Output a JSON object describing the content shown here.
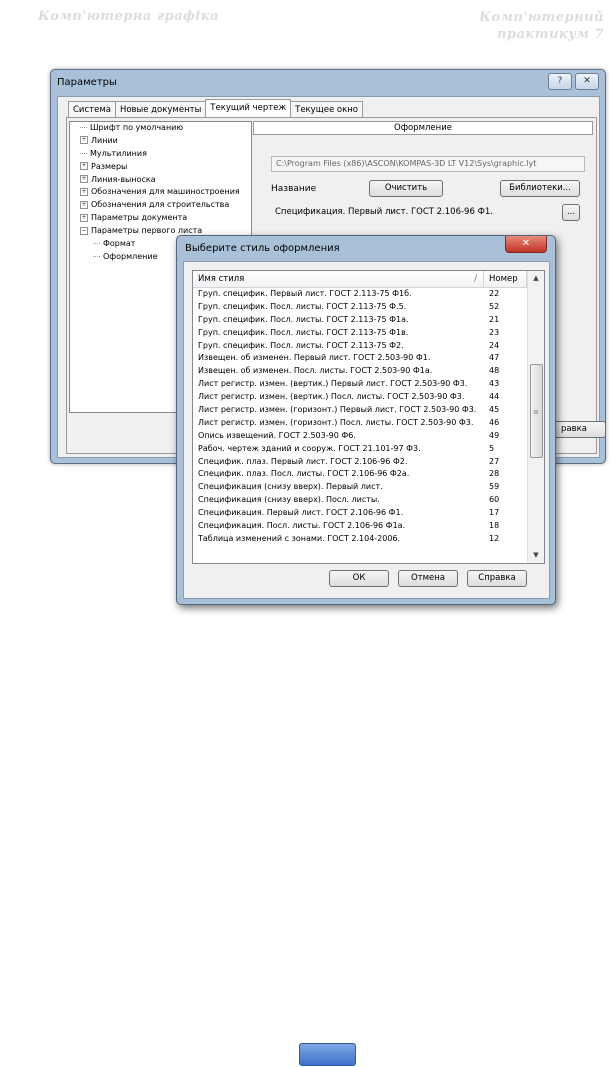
{
  "page_header": {
    "left": "Комп'ютерна графіка",
    "right_line1": "Комп'ютерний",
    "right_line2": "практикум 7"
  },
  "params_window": {
    "title": "Параметры",
    "help_icon": "?",
    "close_icon": "✕",
    "tabs": [
      "Система",
      "Новые документы",
      "Текущий чертеж",
      "Текущее окно"
    ],
    "active_tab": "Текущий чертеж",
    "tree": [
      {
        "label": "Шрифт по умолчанию",
        "expandable": false
      },
      {
        "label": "Линии",
        "expandable": true
      },
      {
        "label": "Мультилиния",
        "expandable": false
      },
      {
        "label": "Размеры",
        "expandable": true
      },
      {
        "label": "Линия-выноска",
        "expandable": true
      },
      {
        "label": "Обозначения для машиностроения",
        "expandable": true
      },
      {
        "label": "Обозначения для строительства",
        "expandable": true
      },
      {
        "label": "Параметры документа",
        "expandable": true
      },
      {
        "label": "Параметры первого листа",
        "expandable": true,
        "expanded": true
      },
      {
        "label": "Формат",
        "expandable": false,
        "child": true
      },
      {
        "label": "Оформление",
        "expandable": false,
        "child": true
      }
    ],
    "panel_title": "Оформление",
    "file_path": "C:\\Program Files (x86)\\ASCON\\KOMPAS-3D LT V12\\Sys\\graphic.lyt",
    "name_label": "Название",
    "clear_button": "Очистить",
    "libraries_button": "Библиотеки...",
    "style_value": "Спецификация. Первый лист. ГОСТ 2.106-96 Ф1.",
    "dots_button": "...",
    "bottom_button_partial": "равка"
  },
  "style_dialog": {
    "title": "Выберите стиль оформления",
    "close_icon": "✕",
    "col_name": "Имя стиля",
    "sort_indicator": "/",
    "col_number": "Номер",
    "rows": [
      {
        "name": "Груп. специфик. Первый лист. ГОСТ 2.113-75 Ф1б.",
        "num": "22"
      },
      {
        "name": "Груп. специфик. Посл. листы. ГОСТ 2.113-75 Ф.5.",
        "num": "52"
      },
      {
        "name": "Груп. специфик. Посл. листы. ГОСТ 2.113-75 Ф1а.",
        "num": "21"
      },
      {
        "name": "Груп. специфик. Посл. листы. ГОСТ 2.113-75 Ф1в.",
        "num": "23"
      },
      {
        "name": "Груп. специфик. Посл. листы. ГОСТ 2.113-75 Ф2.",
        "num": "24"
      },
      {
        "name": "Извещен. об изменен. Первый лист. ГОСТ 2.503-90 Ф1.",
        "num": "47"
      },
      {
        "name": "Извещен. об изменен. Посл. листы. ГОСТ 2.503-90 Ф1а.",
        "num": "48"
      },
      {
        "name": "Лист регистр. измен. (вертик.) Первый лист. ГОСТ 2.503-90 Ф3.",
        "num": "43"
      },
      {
        "name": "Лист регистр. измен. (вертик.) Посл. листы. ГОСТ 2.503-90 Ф3.",
        "num": "44"
      },
      {
        "name": "Лист регистр. измен. (горизонт.) Первый лист. ГОСТ 2.503-90 Ф3.",
        "num": "45"
      },
      {
        "name": "Лист регистр. измен. (горизонт.) Посл. листы. ГОСТ 2.503-90 Ф3.",
        "num": "46"
      },
      {
        "name": "Опись извещений. ГОСТ 2.503-90 Ф6.",
        "num": "49"
      },
      {
        "name": "Рабоч. чертеж зданий и сооруж. ГОСТ 21.101-97 Ф3.",
        "num": "5"
      },
      {
        "name": "Специфик. плаз. Первый лист. ГОСТ 2.106-96 Ф2.",
        "num": "27"
      },
      {
        "name": "Специфик. плаз. Посл. листы. ГОСТ 2.106-96 Ф2а.",
        "num": "28"
      },
      {
        "name": "Спецификация (снизу вверх). Первый лист.",
        "num": "59"
      },
      {
        "name": "Спецификация (снизу вверх). Посл. листы.",
        "num": "60"
      },
      {
        "name": "Спецификация. Первый лист. ГОСТ 2.106-96 Ф1.",
        "num": "17"
      },
      {
        "name": "Спецификация. Посл. листы. ГОСТ 2.106-96 Ф1а.",
        "num": "18"
      },
      {
        "name": "Таблица изменений с зонами. ГОСТ 2.104-2006.",
        "num": "12"
      }
    ],
    "ok_button": "ОК",
    "cancel_button": "Отмена",
    "help_button": "Справка"
  }
}
